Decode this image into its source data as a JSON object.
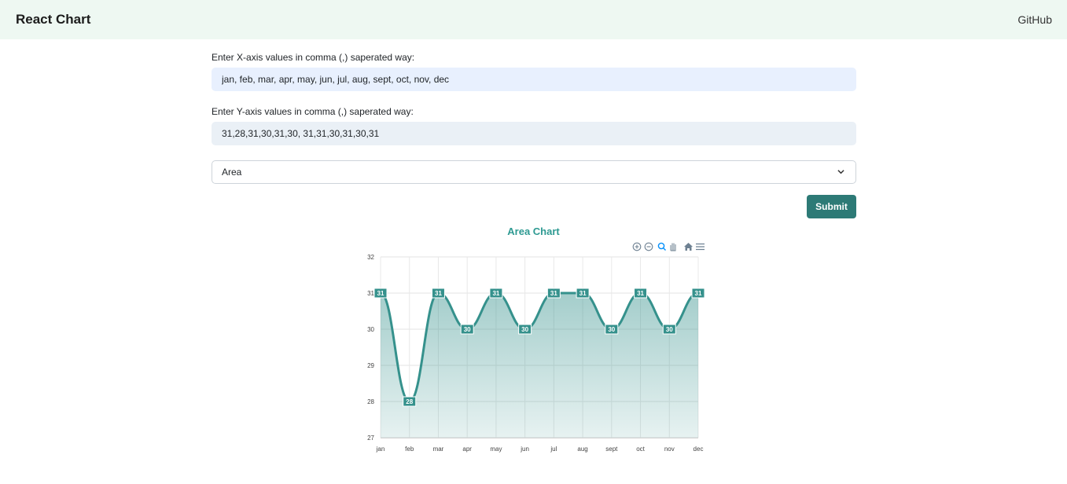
{
  "navbar": {
    "brand": "React Chart",
    "github": "GitHub"
  },
  "form": {
    "x_label": "Enter X-axis values in comma (,) saperated way:",
    "x_value": "jan, feb, mar, apr, may, jun, jul, aug, sept, oct, nov, dec",
    "y_label": "Enter Y-axis values in comma (,) saperated way:",
    "y_value": "31,28,31,30,31,30, 31,31,30,31,30,31",
    "chart_type": "Area",
    "submit_label": "Submit"
  },
  "toolbar_icons": [
    "zoom-in-icon",
    "zoom-out-icon",
    "zoom-icon",
    "pan-icon",
    "home-icon",
    "menu-icon"
  ],
  "chart_data": {
    "type": "area",
    "title": "Area Chart",
    "categories": [
      "jan",
      "feb",
      "mar",
      "apr",
      "may",
      "jun",
      "jul",
      "aug",
      "sept",
      "oct",
      "nov",
      "dec"
    ],
    "series": [
      {
        "values": [
          31,
          28,
          31,
          30,
          31,
          30,
          31,
          31,
          30,
          31,
          30,
          31
        ]
      }
    ],
    "ylim": [
      27,
      32
    ],
    "yticks": [
      "27",
      "28",
      "29",
      "30",
      "31",
      "32"
    ],
    "grid": true,
    "data_labels": true,
    "color": "#35918c"
  }
}
